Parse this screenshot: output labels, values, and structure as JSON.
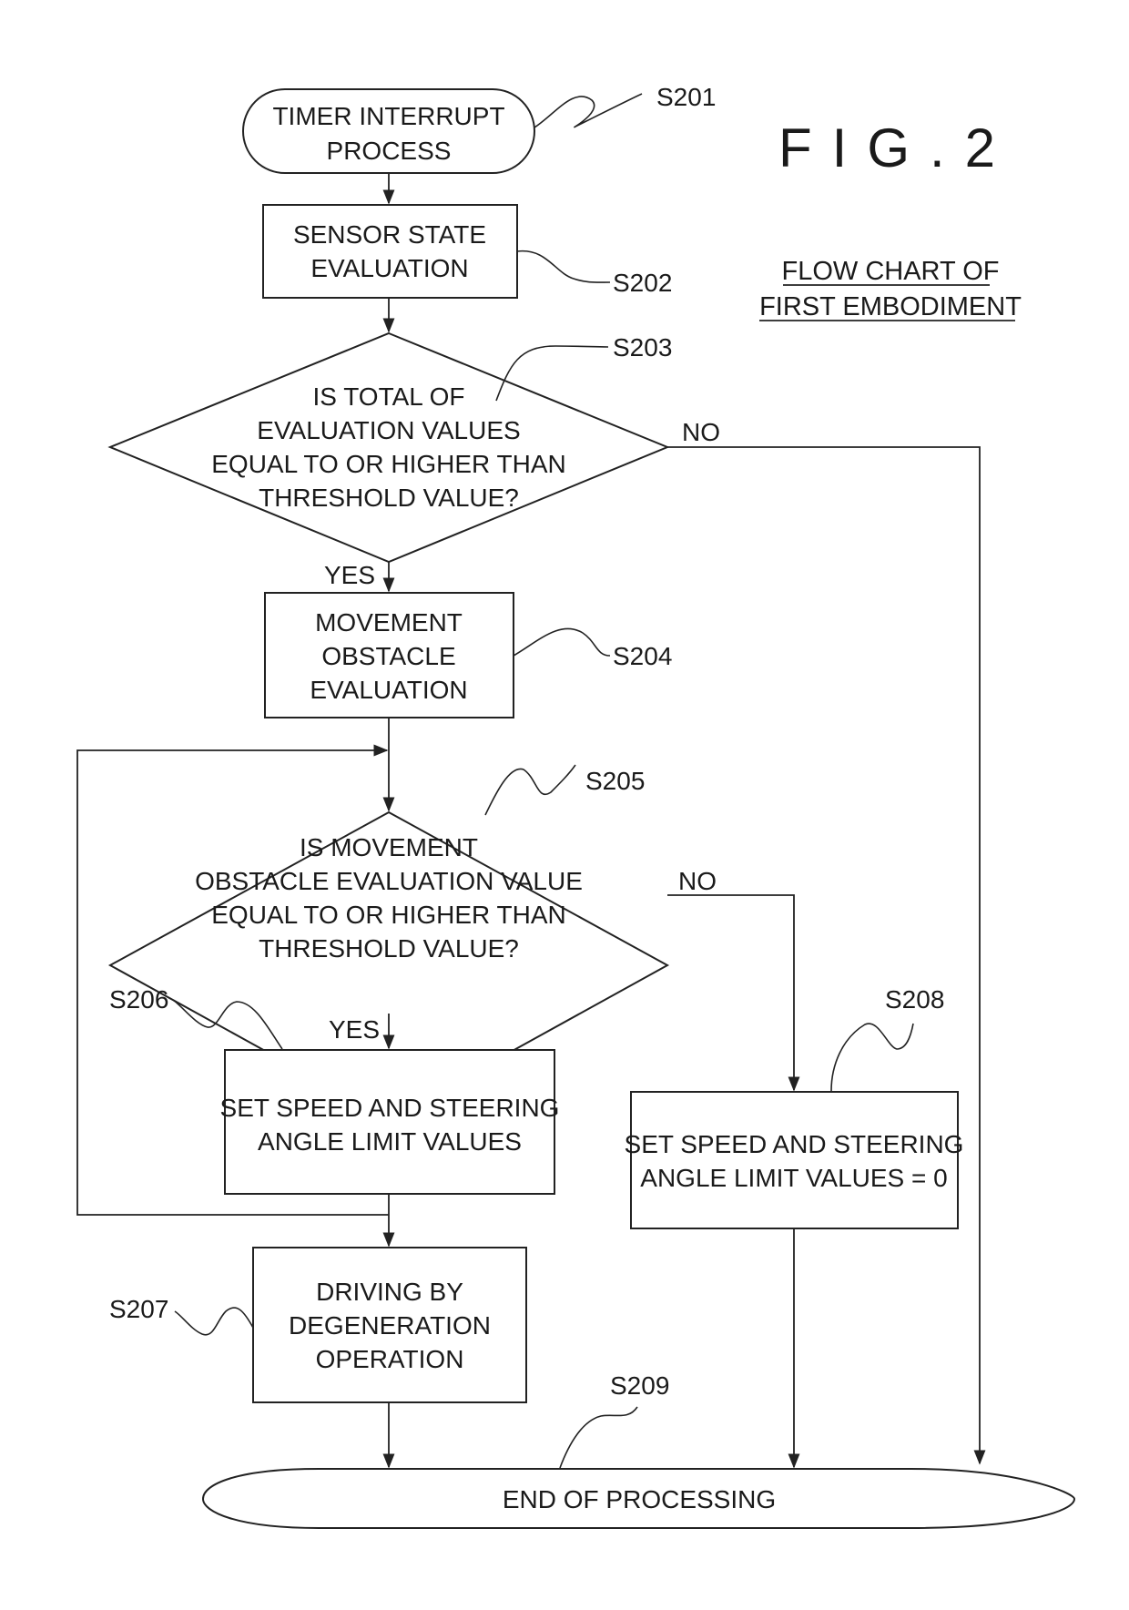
{
  "figure": {
    "label": "FIG.2",
    "title_lines": [
      "FLOW CHART OF",
      "FIRST EMBODIMENT"
    ]
  },
  "steps": {
    "s201": {
      "id": "S201",
      "type": "terminal",
      "lines": [
        "TIMER INTERRUPT",
        "PROCESS"
      ]
    },
    "s202": {
      "id": "S202",
      "type": "process",
      "lines": [
        "SENSOR STATE",
        "EVALUATION"
      ]
    },
    "s203": {
      "id": "S203",
      "type": "decision",
      "lines": [
        "IS TOTAL OF",
        "EVALUATION VALUES",
        "EQUAL TO OR HIGHER THAN",
        "THRESHOLD VALUE?"
      ],
      "yes": "YES",
      "no": "NO"
    },
    "s204": {
      "id": "S204",
      "type": "process",
      "lines": [
        "MOVEMENT",
        "OBSTACLE",
        "EVALUATION"
      ]
    },
    "s205": {
      "id": "S205",
      "type": "decision",
      "lines": [
        "IS MOVEMENT",
        "OBSTACLE EVALUATION VALUE",
        "EQUAL TO OR HIGHER THAN",
        "THRESHOLD VALUE?"
      ],
      "yes": "YES",
      "no": "NO"
    },
    "s206": {
      "id": "S206",
      "type": "process",
      "lines": [
        "SET SPEED AND STEERING",
        "ANGLE LIMIT VALUES"
      ]
    },
    "s207": {
      "id": "S207",
      "type": "process",
      "lines": [
        "DRIVING BY",
        "DEGENERATION",
        "OPERATION"
      ]
    },
    "s208": {
      "id": "S208",
      "type": "process",
      "lines": [
        "SET SPEED AND STEERING",
        "ANGLE LIMIT VALUES = 0"
      ]
    },
    "s209": {
      "id": "S209",
      "type": "terminal",
      "lines": [
        "END OF PROCESSING"
      ]
    }
  }
}
